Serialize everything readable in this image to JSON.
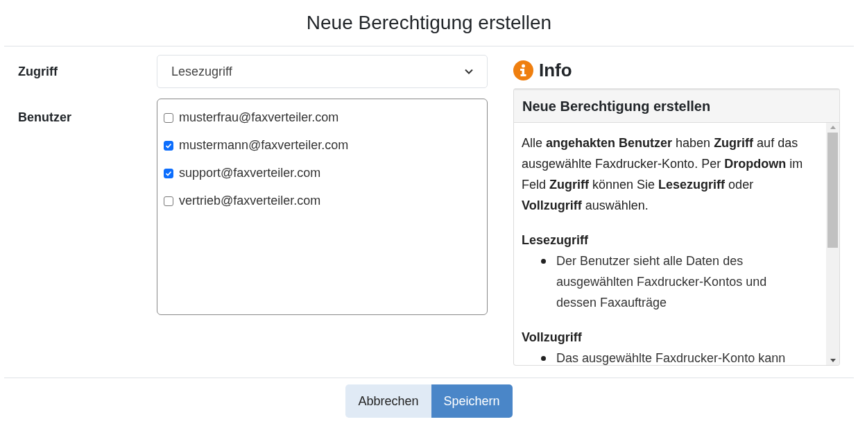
{
  "dialog": {
    "title": "Neue Berechtigung erstellen"
  },
  "access": {
    "label": "Zugriff",
    "value": "Lesezugriff"
  },
  "users": {
    "label": "Benutzer",
    "items": [
      {
        "email": "musterfrau@faxverteiler.com",
        "checked": false
      },
      {
        "email": "mustermann@faxverteiler.com",
        "checked": true
      },
      {
        "email": "support@faxverteiler.com",
        "checked": true
      },
      {
        "email": "vertrieb@faxverteiler.com",
        "checked": false
      }
    ]
  },
  "info": {
    "heading": "Info",
    "card_title": "Neue Berechtigung erstellen",
    "paragraph": "Alle **angehakten Benutzer** haben **Zugriff** auf das ausgewählte Faxdrucker-Konto. Per **Dropdown** im Feld **Zugriff** können Sie **Lesezugriff** oder **Vollzugriff** auswählen.",
    "sections": [
      {
        "heading": "Lesezugriff",
        "items": [
          "Der Benutzer sieht alle Daten des ausgewählten Faxdrucker-Kontos und dessen Faxaufträge"
        ]
      },
      {
        "heading": "Vollzugriff",
        "items": [
          "Das ausgewählte Faxdrucker-Konto kann"
        ]
      }
    ]
  },
  "buttons": [
    {
      "label": "Abbrechen",
      "kind": "secondary"
    },
    {
      "label": "Speichern",
      "kind": "primary"
    }
  ]
}
